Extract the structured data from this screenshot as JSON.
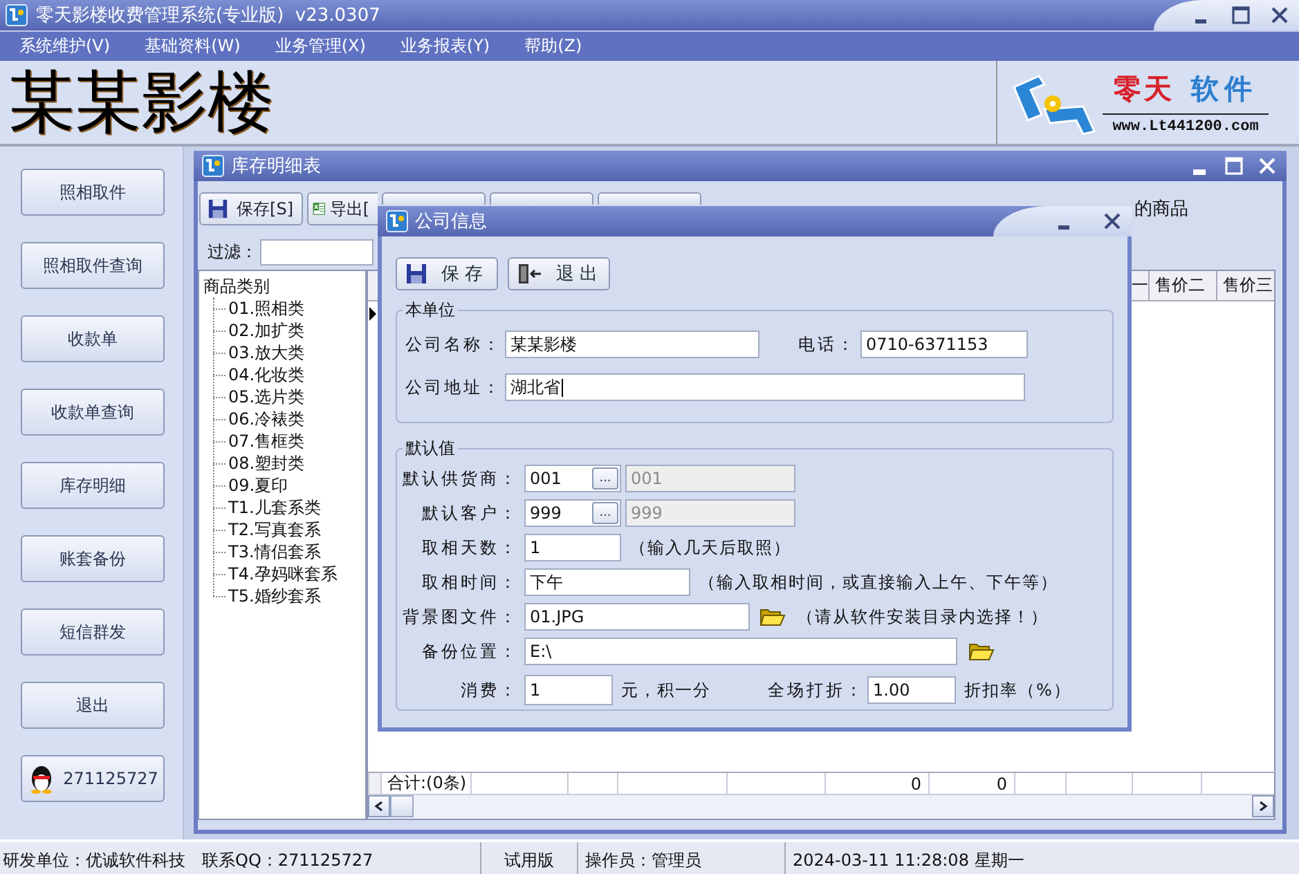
{
  "window": {
    "title": "零天影楼收费管理系统(专业版)  v23.0307"
  },
  "menu": [
    {
      "label": "系统维护(V)"
    },
    {
      "label": "基础资料(W)"
    },
    {
      "label": "业务管理(X)"
    },
    {
      "label": "业务报表(Y)"
    },
    {
      "label": "帮助(Z)"
    }
  ],
  "banner": {
    "title": "某某影楼",
    "logo_name": "零天",
    "logo_sub": "软件",
    "logo_url": "www.Lt441200.com"
  },
  "sidebar": {
    "buttons": [
      {
        "label": "照相取件"
      },
      {
        "label": "照相取件查询"
      },
      {
        "label": "收款单"
      },
      {
        "label": "收款单查询"
      },
      {
        "label": "库存明细"
      },
      {
        "label": "账套备份"
      },
      {
        "label": "短信群发"
      },
      {
        "label": "退出"
      }
    ],
    "qq": "271125727"
  },
  "inventory_window": {
    "title": "库存明细表",
    "toolbar": [
      {
        "label": "保存[S]",
        "kind": "save"
      },
      {
        "label": "导出[",
        "kind": "export"
      },
      {
        "kind": "covered"
      },
      {
        "kind": "covered"
      },
      {
        "kind": "covered"
      }
    ],
    "stock_checkbox_label": "的商品",
    "filter_label": "过滤：",
    "tree": {
      "label": "商品类别",
      "children": [
        {
          "label": "01.照相类"
        },
        {
          "label": "02.加扩类"
        },
        {
          "label": "03.放大类"
        },
        {
          "label": "04.化妆类"
        },
        {
          "label": "05.选片类"
        },
        {
          "label": "06.冷裱类"
        },
        {
          "label": "07.售框类"
        },
        {
          "label": "08.塑封类"
        },
        {
          "label": "09.夏印"
        },
        {
          "label": "T1.儿套系类"
        },
        {
          "label": "T2.写真套系"
        },
        {
          "label": "T3.情侣套系"
        },
        {
          "label": "T4.孕妈咪套系"
        },
        {
          "label": "T5.婚纱套系"
        }
      ]
    },
    "table": {
      "columns": [
        "一",
        "售价二",
        "售价三"
      ],
      "footer": {
        "label": "合计:(0条)",
        "totals": [
          "0",
          "0"
        ]
      }
    }
  },
  "dialog": {
    "title": "公司信息",
    "buttons": [
      {
        "label": "保 存",
        "kind": "save"
      },
      {
        "label": "退 出",
        "kind": "exit"
      }
    ],
    "company": {
      "title": "本单位",
      "name_label": "公司名称：",
      "name": "某某影楼",
      "phone_label": "电话：",
      "phone": "0710-6371153",
      "address_label": "公司地址：",
      "address": "湖北省"
    },
    "defaults": {
      "title": "默认值",
      "rows": [
        {
          "kind": "lookup",
          "label": "默认供货商：",
          "value": "001",
          "button": "...",
          "display": {
            "value": "001",
            "disabled": true
          }
        },
        {
          "kind": "lookup",
          "label": "默认客户：",
          "value": "999",
          "button": "...",
          "display": {
            "value": "999",
            "disabled": true
          }
        },
        {
          "kind": "text",
          "label": "取相天数：",
          "value": "1",
          "hint": "（输入几天后取照）"
        },
        {
          "kind": "text",
          "label": "取相时间：",
          "value": "下午",
          "hint": "（输入取相时间，或直接输入上午、下午等）"
        },
        {
          "kind": "file",
          "label": "背景图文件：",
          "value": "01.JPG",
          "hint": "（请从软件安装目录内选择！）"
        },
        {
          "kind": "folder",
          "label": "备份位置：",
          "value": "E:\\"
        },
        {
          "kind": "pair",
          "label": "消费：",
          "value": "1",
          "unit": "元，积一分",
          "label2": "全场打折：",
          "value2": "1.00",
          "unit2": "折扣率（%）"
        }
      ]
    }
  },
  "status_bar": {
    "developer": "研发单位：优诚软件科技",
    "contact": "联系QQ：271125727",
    "edition": "试用版",
    "operator": "操作员：管理员",
    "datetime": "2024-03-11 11:28:08 星期一"
  }
}
